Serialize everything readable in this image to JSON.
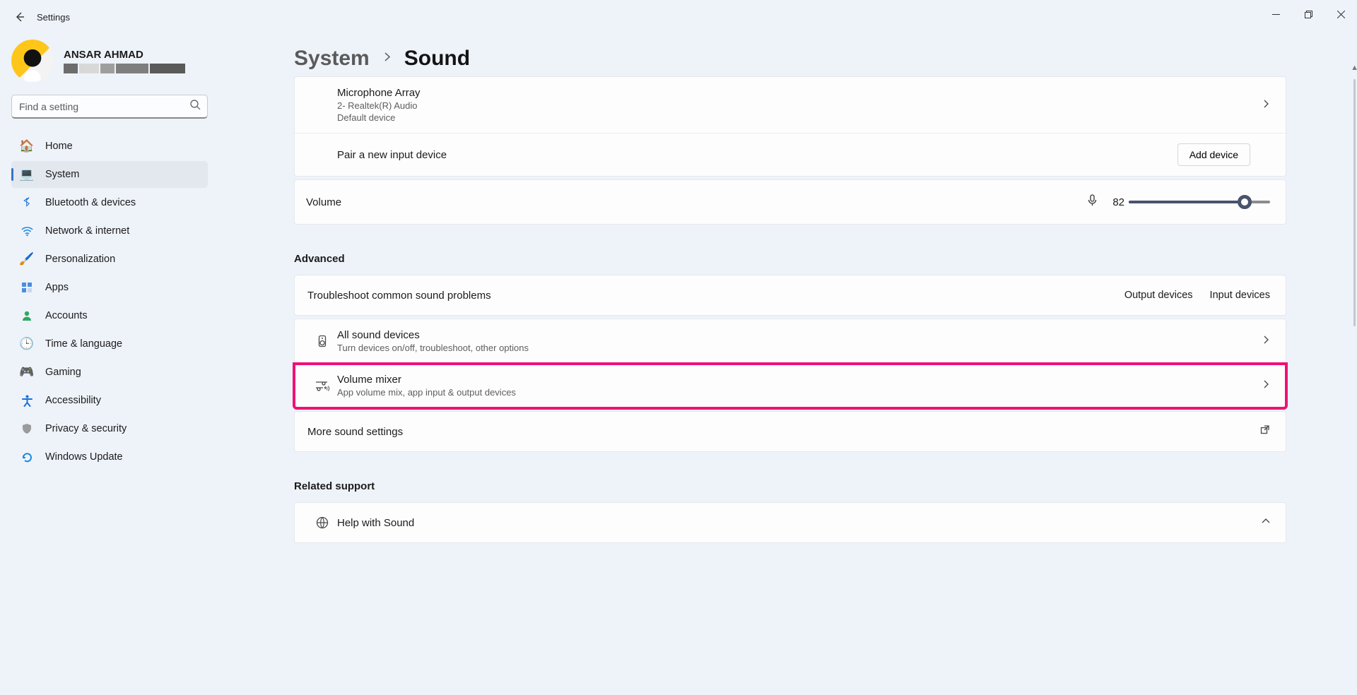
{
  "window": {
    "title": "Settings"
  },
  "user": {
    "name": "ANSAR AHMAD"
  },
  "search": {
    "placeholder": "Find a setting"
  },
  "nav": {
    "home": "Home",
    "system": "System",
    "bluetooth": "Bluetooth & devices",
    "network": "Network & internet",
    "personalization": "Personalization",
    "apps": "Apps",
    "accounts": "Accounts",
    "time": "Time & language",
    "gaming": "Gaming",
    "accessibility": "Accessibility",
    "privacy": "Privacy & security",
    "update": "Windows Update"
  },
  "breadcrumb": {
    "parent": "System",
    "current": "Sound"
  },
  "mic": {
    "title": "Microphone Array",
    "sub1": "2- Realtek(R) Audio",
    "sub2": "Default device"
  },
  "pair": {
    "label": "Pair a new input device",
    "button": "Add device"
  },
  "volume": {
    "label": "Volume",
    "value": "82",
    "percent": 82
  },
  "sections": {
    "advanced": "Advanced",
    "related": "Related support"
  },
  "troubleshoot": {
    "label": "Troubleshoot common sound problems",
    "out": "Output devices",
    "in": "Input devices"
  },
  "allSound": {
    "title": "All sound devices",
    "sub": "Turn devices on/off, troubleshoot, other options"
  },
  "mixer": {
    "title": "Volume mixer",
    "sub": "App volume mix, app input & output devices"
  },
  "more": {
    "label": "More sound settings"
  },
  "help": {
    "label": "Help with Sound"
  }
}
